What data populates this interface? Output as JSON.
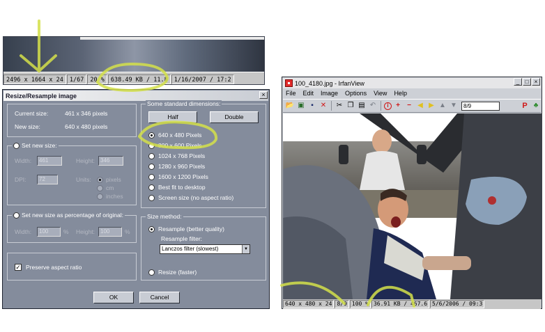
{
  "top_fragment": {
    "status": [
      "2496 x 1664 x 24",
      "1/67",
      "20 %",
      "638.49 KB / 11.8",
      "1/16/2007 / 17:2"
    ]
  },
  "dialog": {
    "title": "Resize/Resample image",
    "close_glyph": "×",
    "current_size_label": "Current size:",
    "current_size_value": "461 x 346  pixels",
    "new_size_label": "New size:",
    "new_size_value": "640 x 480  pixels",
    "set_new_size_label": "Set new size:",
    "width_label": "Width:",
    "width_value": "461",
    "height_label": "Height:",
    "height_value": "346",
    "dpi_label": "DPI:",
    "dpi_value": "72",
    "units_label": "Units:",
    "units_options": [
      "pixels",
      "cm",
      "inches"
    ],
    "percentage_label": "Set new size as percentage of original:",
    "pct_width_label": "Width:",
    "pct_width_value": "100",
    "pct_height_label": "Height:",
    "pct_height_value": "100",
    "percent_sign": "%",
    "preserve_label": "Preserve aspect ratio",
    "preserve_checked": true,
    "standard_dims_label": "Some standard dimensions:",
    "half_label": "Half",
    "double_label": "Double",
    "dim_options": [
      "640 x 480 Pixels",
      "800 x 600 Pixels",
      "1024 x 768 Pixels",
      "1280 x 960 Pixels",
      "1600 x 1200 Pixels",
      "Best fit to desktop",
      "Screen size (no aspect ratio)"
    ],
    "selected_dim": 0,
    "size_method_label": "Size method:",
    "resample_label": "Resample (better quality)",
    "resample_filter_label": "Resample filter:",
    "resample_filter_value": "Lanczos filter (slowest)",
    "resize_label": "Resize (faster)",
    "ok_label": "OK",
    "cancel_label": "Cancel"
  },
  "irfanview": {
    "title": "100_4180.jpg - IrfanView",
    "window_buttons": [
      "_",
      "□",
      "×"
    ],
    "menus": [
      "File",
      "Edit",
      "Image",
      "Options",
      "View",
      "Help"
    ],
    "toolbar_page": "8/9",
    "toolbar_icons": {
      "open": "📂",
      "slideshow": "▣",
      "save": "▪",
      "delete": "✕",
      "cut": "✂",
      "copy": "❐",
      "paste": "▤",
      "undo": "↶",
      "info": "i",
      "zoom_in": "+",
      "zoom_out": "−",
      "prev": "◀",
      "next": "▶",
      "first": "▲",
      "last": "▼",
      "print": "P",
      "about": "♣"
    },
    "status": [
      "640 x 480 x 24",
      "8/9",
      "100 %",
      "36.91 KB / 467.6",
      "5/6/2006 / 09:3"
    ]
  }
}
